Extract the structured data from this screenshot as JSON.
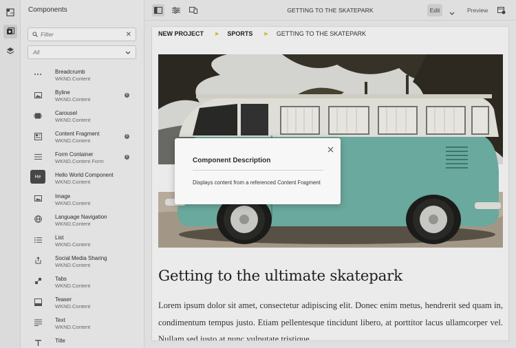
{
  "rail": {
    "icons": [
      "site-structure-icon",
      "add-component-icon",
      "layers-icon"
    ]
  },
  "panel": {
    "title": "Components",
    "filter_placeholder": "Filter",
    "group_select": "All",
    "components": [
      {
        "name": "Breadcrumb",
        "group": "WKND.Content",
        "icon": "ellipsis-icon",
        "info": false
      },
      {
        "name": "Byline",
        "group": "WKND.Content",
        "icon": "image-icon",
        "info": true
      },
      {
        "name": "Carousel",
        "group": "WKND.Content",
        "icon": "carousel-icon",
        "info": false
      },
      {
        "name": "Content Fragment",
        "group": "WKND.Content",
        "icon": "content-fragment-icon",
        "info": true
      },
      {
        "name": "Form Container",
        "group": "WKND.Content Form",
        "icon": "form-icon",
        "info": true
      },
      {
        "name": "Hello World Component",
        "group": "WKND.Content",
        "icon": "he-badge",
        "badge": "He",
        "info": false
      },
      {
        "name": "Image",
        "group": "WKND.Content",
        "icon": "image-icon",
        "info": false
      },
      {
        "name": "Language Navigation",
        "group": "WKND.Content",
        "icon": "globe-icon",
        "info": false
      },
      {
        "name": "List",
        "group": "WKND.Content",
        "icon": "list-icon",
        "info": false
      },
      {
        "name": "Social Media Sharing",
        "group": "WKND.Content",
        "icon": "share-icon",
        "info": false
      },
      {
        "name": "Tabs",
        "group": "WKND.Content",
        "icon": "tabs-icon",
        "info": false
      },
      {
        "name": "Teaser",
        "group": "WKND.Content",
        "icon": "teaser-icon",
        "info": false
      },
      {
        "name": "Text",
        "group": "WKND.Content",
        "icon": "text-icon",
        "info": false
      },
      {
        "name": "Title",
        "group": "",
        "icon": "title-icon",
        "info": false
      }
    ]
  },
  "toolbar": {
    "title": "GETTING TO THE SKATEPARK",
    "edit_label": "Edit",
    "preview_label": "Preview"
  },
  "page": {
    "breadcrumb": [
      "NEW PROJECT",
      "SPORTS",
      "GETTING TO THE SKATEPARK"
    ],
    "hero_alt": "vintage-van-photo",
    "heading": "Getting to the ultimate skatepark",
    "paragraph": "Lorem ipsum dolor sit amet, consectetur adipiscing elit. Donec enim metus, hendrerit sed quam in, condimentum tempus justo. Etiam pellentesque tincidunt libero, at porttitor lacus ullamcorper vel. Nullam sed justo at nunc vulputate tristique."
  },
  "dialog": {
    "title": "Component Description",
    "description": "Displays content from a referenced Content Fragment"
  },
  "colors": {
    "breadcrumb_separator": "#d2c238",
    "van_body": "#6fb0a4",
    "van_roof": "#e8e6df"
  }
}
